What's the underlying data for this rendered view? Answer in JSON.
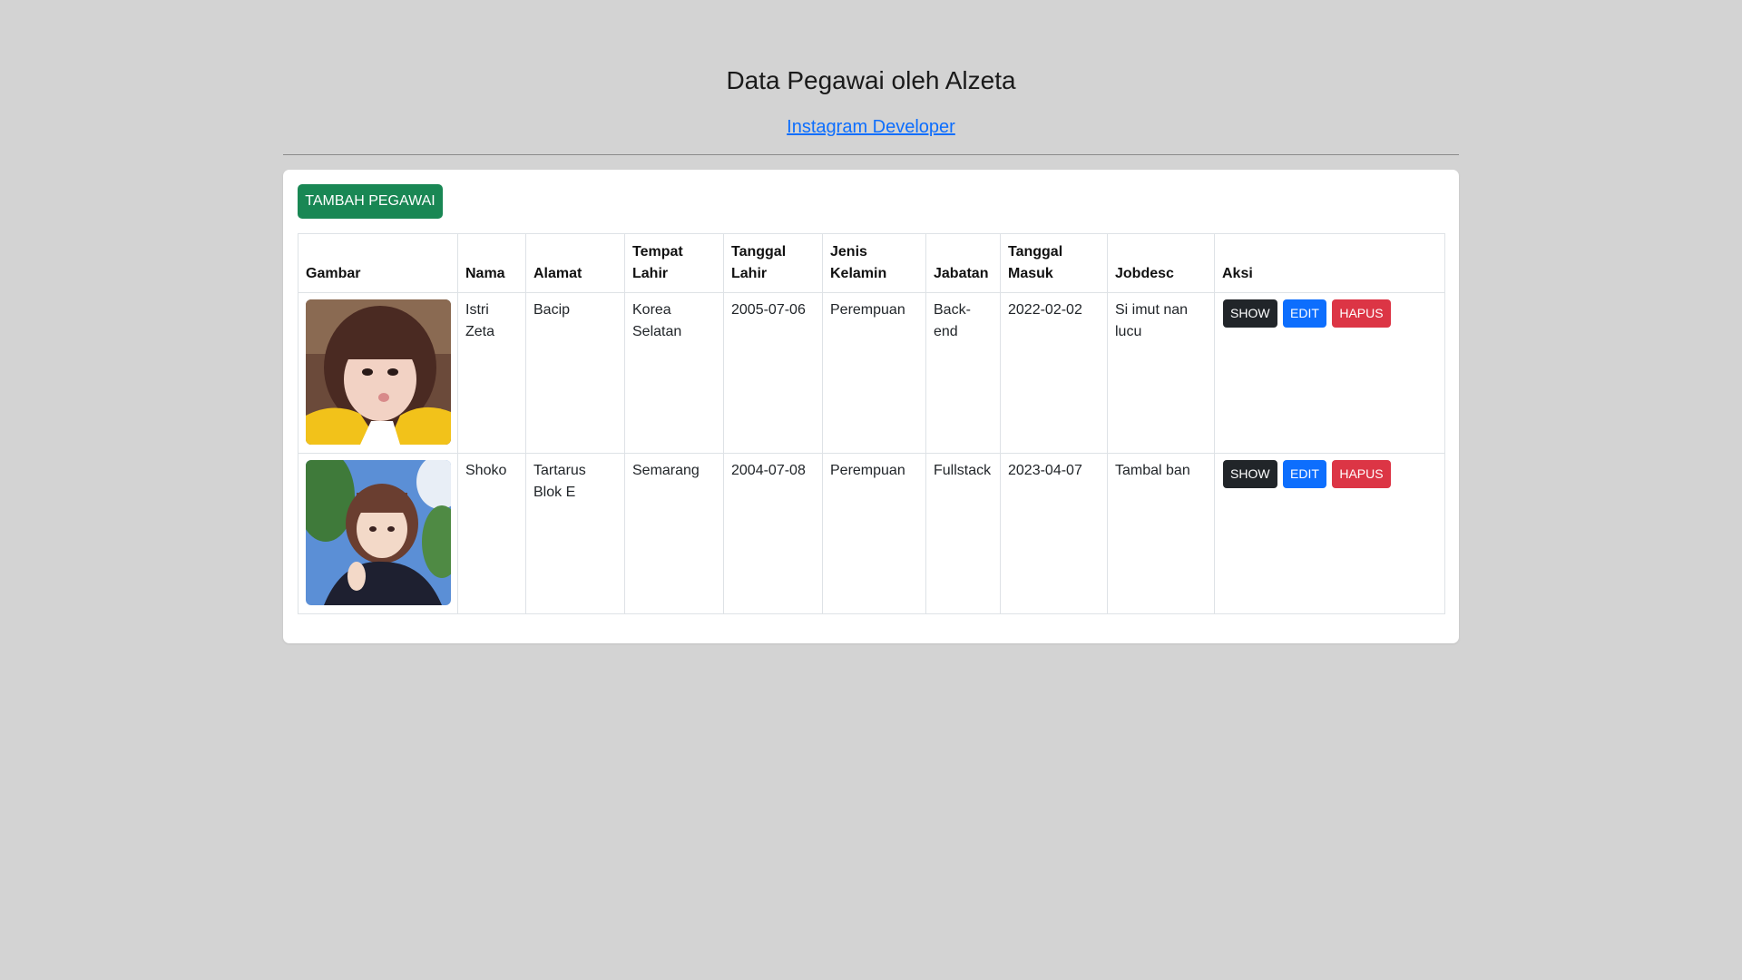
{
  "header": {
    "title": "Data Pegawai oleh Alzeta",
    "link_text": "Instagram Developer"
  },
  "toolbar": {
    "add_label": "TAMBAH PEGAWAI"
  },
  "table": {
    "columns": [
      "Gambar",
      "Nama",
      "Alamat",
      "Tempat Lahir",
      "Tanggal Lahir",
      "Jenis Kelamin",
      "Jabatan",
      "Tanggal Masuk",
      "Jobdesc",
      "Aksi"
    ],
    "rows": [
      {
        "nama": "Istri Zeta",
        "alamat": "Bacip",
        "tempat_lahir": "Korea Selatan",
        "tanggal_lahir": "2005-07-06",
        "jenis_kelamin": "Perempuan",
        "jabatan": "Back-end",
        "tanggal_masuk": "2022-02-02",
        "jobdesc": "Si imut nan lucu"
      },
      {
        "nama": "Shoko",
        "alamat": "Tartarus Blok E",
        "tempat_lahir": "Semarang",
        "tanggal_lahir": "2004-07-08",
        "jenis_kelamin": "Perempuan",
        "jabatan": "Fullstack",
        "tanggal_masuk": "2023-04-07",
        "jobdesc": "Tambal ban"
      }
    ],
    "actions": {
      "show": "SHOW",
      "edit": "EDIT",
      "hapus": "HAPUS"
    }
  },
  "colors": {
    "background": "#d3d3d3",
    "add_button": "#198754",
    "show_button": "#212529",
    "edit_button": "#0d6efd",
    "hapus_button": "#dc3545",
    "link": "#0d6efd"
  }
}
